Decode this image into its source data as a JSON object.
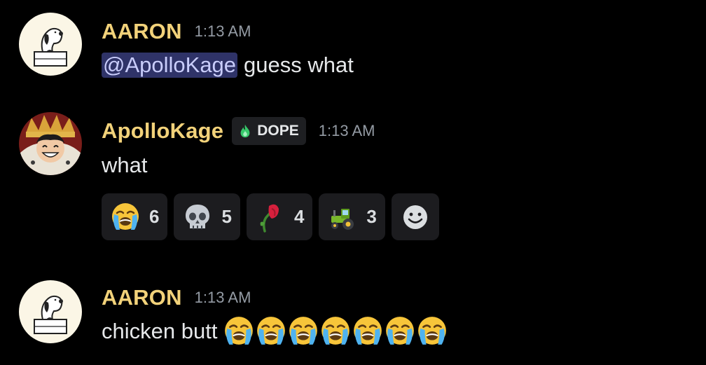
{
  "messages": [
    {
      "author": "AARON",
      "time": "1:13 AM",
      "avatar_icon": "snoopy-avatar",
      "mention": "@ApolloKage",
      "text": "guess what"
    },
    {
      "author": "ApolloKage",
      "time": "1:13 AM",
      "avatar_icon": "luffy-avatar",
      "badge": {
        "icon": "green-flame-icon",
        "label": "DOPE"
      },
      "text": "what",
      "reactions": [
        {
          "icon": "loudly-crying-face-icon",
          "count": "6"
        },
        {
          "icon": "skull-icon",
          "count": "5"
        },
        {
          "icon": "wilted-flower-icon",
          "count": "4"
        },
        {
          "icon": "tractor-icon",
          "count": "3"
        }
      ],
      "add_reaction_icon": "add-reaction-smiley-icon"
    },
    {
      "author": "AARON",
      "time": "1:13 AM",
      "avatar_icon": "snoopy-avatar",
      "text": "chicken butt",
      "trailing_emoji": {
        "icon": "loudly-crying-face-icon",
        "repeat": 7
      }
    }
  ],
  "colors": {
    "background": "#000000",
    "username": "#f2d27a",
    "timestamp": "#949ba4",
    "mention_bg": "#2f3368",
    "mention_text": "#c9cdfb",
    "reaction_bg": "#1c1c1f"
  }
}
